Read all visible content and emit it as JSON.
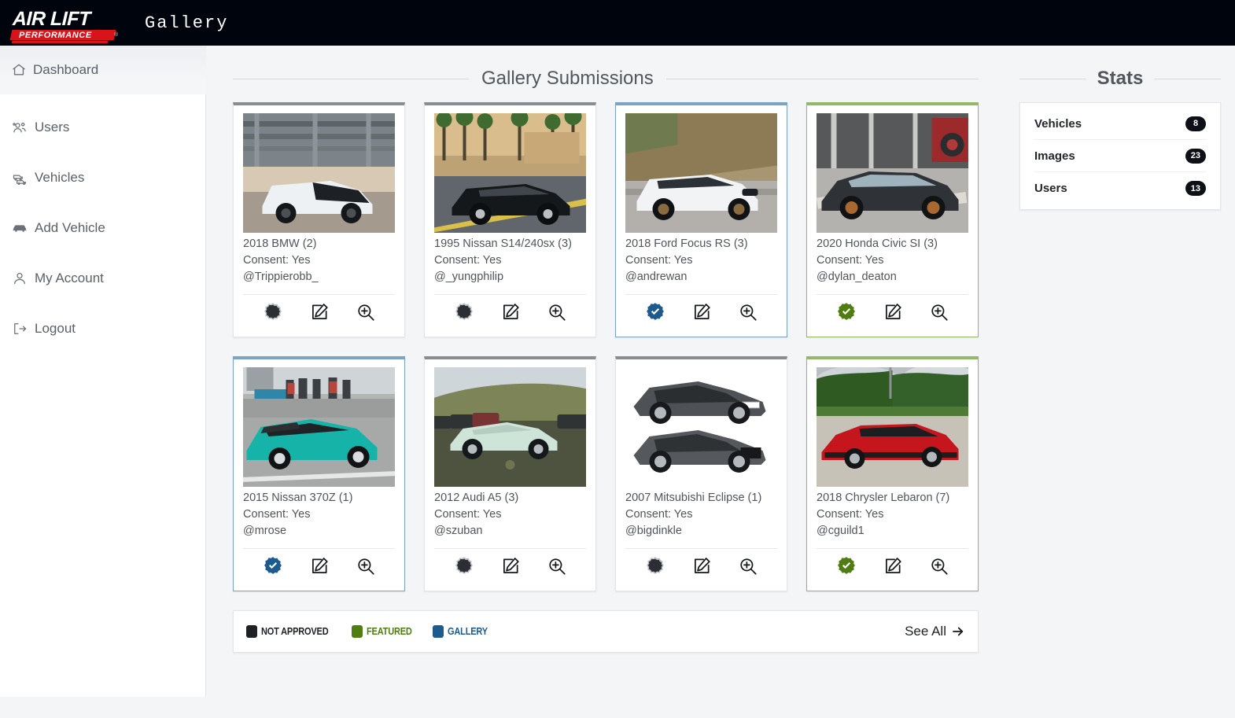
{
  "header": {
    "logo_line1": "AIR LIFT",
    "logo_line2": "PERFORMANCE",
    "logo_reg": "®",
    "app_title": "Gallery"
  },
  "breadcrumb": {
    "label": "Dashboard",
    "icon": "home-icon"
  },
  "sidebar": {
    "items": [
      {
        "label": "Users",
        "icon": "users-icon"
      },
      {
        "label": "Vehicles",
        "icon": "cars-icon"
      },
      {
        "label": "Add Vehicle",
        "icon": "car-icon"
      },
      {
        "label": "My Account",
        "icon": "user-icon"
      },
      {
        "label": "Logout",
        "icon": "logout-icon"
      }
    ]
  },
  "main": {
    "section_title": "Gallery Submissions",
    "consent_label": "Consent: Yes",
    "cards": [
      {
        "title": "2018 BMW (2)",
        "consent": "Consent: Yes",
        "handle": "@Trippierobb_",
        "status": "none",
        "badge_color": "#2b2f33",
        "photo": "bmw-white-parking-garage"
      },
      {
        "title": "1995 Nissan S14/240sx (3)",
        "consent": "Consent: Yes",
        "handle": "@_yungphilip",
        "status": "none",
        "badge_color": "#2b2f33",
        "photo": "nissan-s14-black-palms"
      },
      {
        "title": "2018 Ford Focus RS (3)",
        "consent": "Consent: Yes",
        "handle": "@andrewan",
        "status": "gallery",
        "badge_color": "#1d5b8e",
        "photo": "ford-focus-rs-white-hillside"
      },
      {
        "title": "2020 Honda Civic SI (3)",
        "consent": "Consent: Yes",
        "handle": "@dylan_deaton",
        "status": "featured",
        "badge_color": "#4f7d12",
        "photo": "honda-civic-si-chrome-garage"
      },
      {
        "title": "2015 Nissan 370Z (1)",
        "consent": "Consent: Yes",
        "handle": "@mrose",
        "status": "gallery",
        "badge_color": "#1d5b8e",
        "photo": "nissan-370z-teal-carshow"
      },
      {
        "title": "2012 Audi A5 (3)",
        "consent": "Consent: Yes",
        "handle": "@szuban",
        "status": "none",
        "badge_color": "#2b2f33",
        "photo": "audi-a5-mint-hillside"
      },
      {
        "title": "2007 Mitsubishi Eclipse (1)",
        "consent": "Consent: Yes",
        "handle": "@bigdinkle",
        "status": "none",
        "badge_color": "#2b2f33",
        "photo": "two-grey-sedans-white-bg"
      },
      {
        "title": "2018 Chrysler Lebaron (7)",
        "consent": "Consent: Yes",
        "handle": "@cguild1",
        "status": "featured",
        "badge_color": "#4f7d12",
        "photo": "chrysler-lebaron-red-convertible"
      }
    ],
    "legend": [
      {
        "label": "NOT APPROVED",
        "color": "#1d2126"
      },
      {
        "label": "FEATURED",
        "color": "#4f7d12"
      },
      {
        "label": "GALLERY",
        "color": "#1d5b8e"
      }
    ],
    "see_all": "See All",
    "see_all_icon": "arrow-right-icon"
  },
  "stats": {
    "title": "Stats",
    "rows": [
      {
        "label": "Vehicles",
        "count": "8"
      },
      {
        "label": "Images",
        "count": "23"
      },
      {
        "label": "Users",
        "count": "13"
      }
    ]
  },
  "action_icons": {
    "approve": "verified-badge-icon",
    "edit": "pen-square-icon",
    "zoom": "magnifier-plus-icon"
  }
}
